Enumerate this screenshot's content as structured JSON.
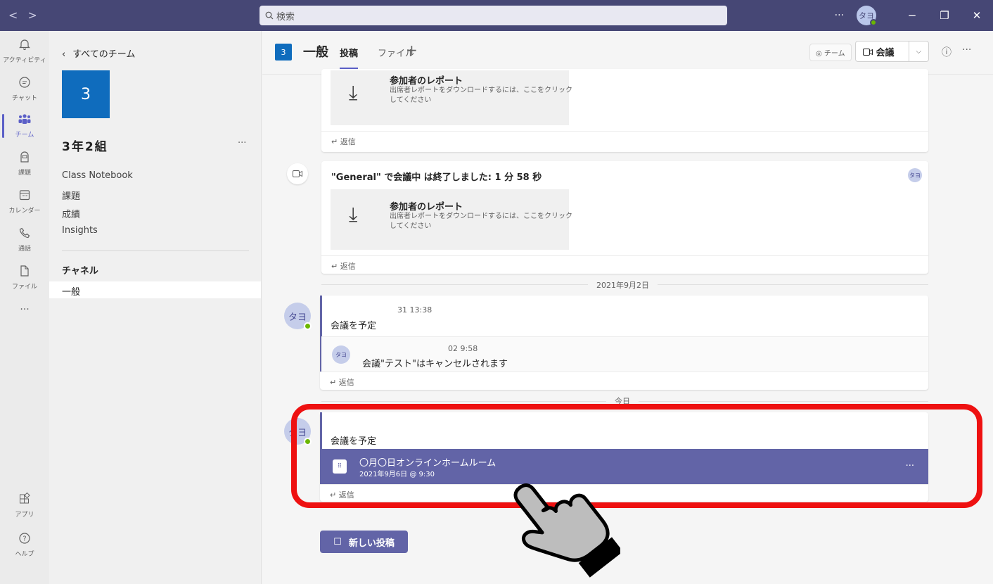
{
  "titlebar": {
    "nav_back": "<",
    "nav_forward": ">",
    "search_placeholder": "検索",
    "more": "···",
    "avatar_initials": "タヨ",
    "minimize": "−",
    "restore": "❐",
    "close": "✕"
  },
  "rail": {
    "items": [
      {
        "label": "アクティビティ",
        "icon": "bell-icon"
      },
      {
        "label": "チャット",
        "icon": "chat-icon"
      },
      {
        "label": "チーム",
        "icon": "teams-icon",
        "active": true
      },
      {
        "label": "課題",
        "icon": "assignments-icon"
      },
      {
        "label": "カレンダー",
        "icon": "calendar-icon"
      },
      {
        "label": "通話",
        "icon": "phone-icon"
      },
      {
        "label": "ファイル",
        "icon": "file-icon"
      }
    ],
    "more": "···",
    "apps_label": "アプリ",
    "help_label": "ヘルプ"
  },
  "team_panel": {
    "back_label": "すべてのチーム",
    "team_tile": "3",
    "team_name": "3年2組",
    "team_more": "···",
    "links": [
      "Class Notebook",
      "課題",
      "成績",
      "Insights"
    ],
    "channels_heading": "チャネル",
    "channels": [
      "一般"
    ]
  },
  "channel_header": {
    "tile": "3",
    "name": "一般",
    "tabs": [
      "投稿",
      "ファイル"
    ],
    "add_tab": "+",
    "team_label": "チーム",
    "meet_label": "会議",
    "info": "ⓘ",
    "more": "···"
  },
  "feed": {
    "reply_label": "返信",
    "report": {
      "title": "参加者のレポート",
      "desc": "出席者レポートをダウンロードするには、ここをクリックしてください"
    },
    "meeting_ended": "\"General\" で会議中 は終了しました: 1 分 58 秒",
    "mini_avatar": "タヨ",
    "date_1": "2021年9月2日",
    "date_2": "今日",
    "thread1": {
      "avatar": "タヨ",
      "meta": "31 13:38",
      "message": "会議を予定",
      "reply_avatar": "タヨ",
      "reply_meta": "02 9:58",
      "reply_message": "会議\"テスト\"はキャンセルされます"
    },
    "thread2": {
      "avatar": "タヨ",
      "message": "会議を予定",
      "event_title": "〇月〇日オンラインホームルーム",
      "event_date": "2021年9月6日 @ 9:30",
      "event_more": "···"
    },
    "new_post_label": "新しい投稿"
  },
  "colors": {
    "titlebar": "#464775",
    "accent": "#6264a7",
    "team_tile": "#0f6cbd",
    "highlight": "#ee1111",
    "presence": "#6bb700"
  }
}
